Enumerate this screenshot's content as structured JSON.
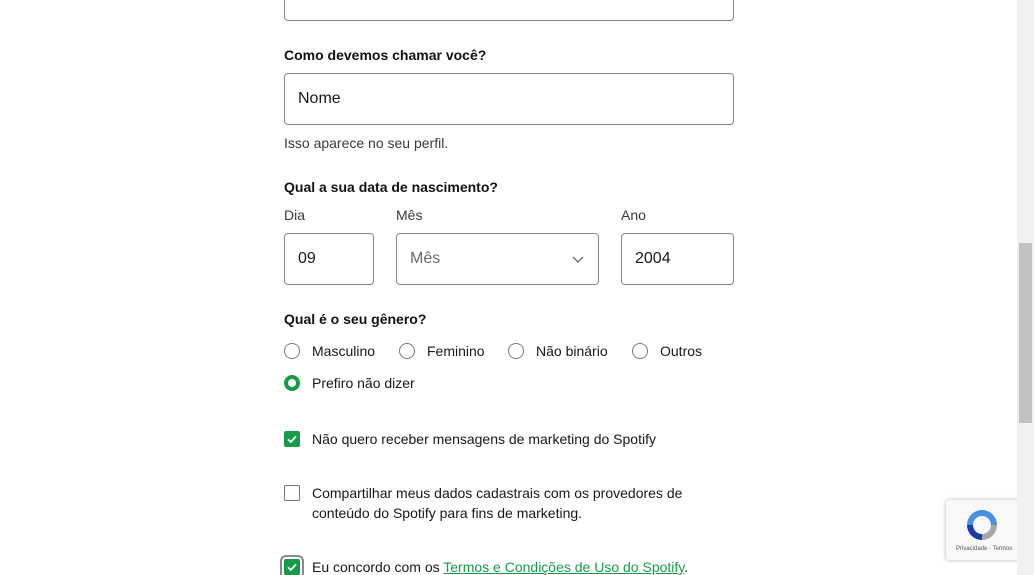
{
  "name_section": {
    "label": "Como devemos chamar você?",
    "value": "Nome",
    "help": "Isso aparece no seu perfil."
  },
  "birth_section": {
    "label": "Qual a sua data de nascimento?",
    "day_label": "Dia",
    "day_value": "09",
    "month_label": "Mês",
    "month_value": "Mês",
    "year_label": "Ano",
    "year_value": "2004"
  },
  "gender_section": {
    "label": "Qual é o seu gênero?",
    "options": [
      {
        "label": "Masculino",
        "checked": false
      },
      {
        "label": "Feminino",
        "checked": false
      },
      {
        "label": "Não binário",
        "checked": false
      },
      {
        "label": "Outros",
        "checked": false
      },
      {
        "label": "Prefiro não dizer",
        "checked": true
      }
    ]
  },
  "consents": {
    "marketing_label": "Não quero receber mensagens de marketing do Spotify",
    "marketing_checked": true,
    "share_label": "Compartilhar meus dados cadastrais com os provedores de conteúdo do Spotify para fins de marketing.",
    "share_checked": false,
    "terms_prefix": "Eu concordo com os ",
    "terms_link": "Termos e Condições de Uso do Spotify",
    "terms_suffix": ".",
    "terms_checked": true
  },
  "recaptcha": {
    "footer": "Privacidade - Termos"
  },
  "colors": {
    "accent": "#169c46",
    "border": "#878787"
  }
}
